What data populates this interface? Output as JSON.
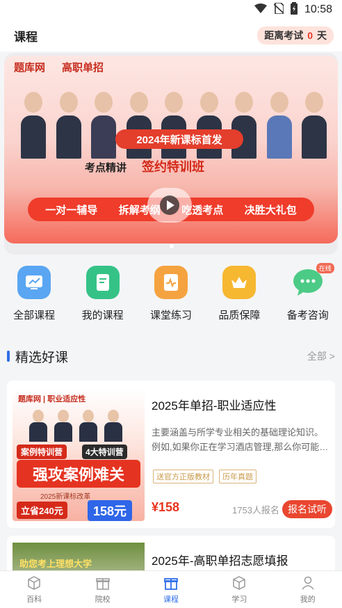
{
  "status_bar": {
    "time": "10:58",
    "icons": [
      "wifi-icon",
      "no-sim-icon",
      "battery-icon"
    ]
  },
  "header": {
    "title": "课程",
    "exam_label": "距离考试",
    "exam_days": "0",
    "exam_unit": "天"
  },
  "banner": {
    "brand_left": "题库网",
    "brand_right": "高职单招",
    "pill": "2024年新课标首发",
    "line_a": "考点精讲",
    "line_b": "签约特训班",
    "features": [
      "一对一辅导",
      "拆解考纲",
      "吃透考点",
      "决胜大礼包"
    ]
  },
  "quick_nav": [
    {
      "label": "全部课程",
      "icon": "chart-screen-icon",
      "color": "#5aa6f2"
    },
    {
      "label": "我的课程",
      "icon": "document-icon",
      "color": "#35c287"
    },
    {
      "label": "课堂练习",
      "icon": "pulse-doc-icon",
      "color": "#f5a340"
    },
    {
      "label": "品质保障",
      "icon": "crown-icon",
      "color": "#f6b731"
    },
    {
      "label": "备考咨询",
      "icon": "chat-bubble-icon",
      "color": "#4ccb86",
      "tag": "在线"
    }
  ],
  "section": {
    "title": "精选好课",
    "more": "全部 >"
  },
  "courses": [
    {
      "title": "2025年单招-职业适应性",
      "desc_line1": "主要涵盖与所学专业相关的基础理论知识。",
      "desc_line2": "例如,如果你正在学习酒店管理,那么你可能…",
      "tags": [
        "送官方正版教材",
        "历年真题"
      ],
      "price": "¥158",
      "enroll": "1753人报名",
      "button": "报名试听",
      "thumb": {
        "brand": "题库网 | 职业适应性",
        "tag1": "案例特训营",
        "tag2": "4大特训营",
        "headline": "强攻案例难关",
        "sub": "2025新课标改革",
        "left": "立省240元",
        "right": "158元"
      }
    },
    {
      "title": "2025年-高职单招志愿填报",
      "thumb": {
        "overlay": "助您考上理想大学"
      }
    }
  ],
  "tabbar": [
    {
      "label": "百科",
      "icon": "cube-icon",
      "active": false
    },
    {
      "label": "院校",
      "icon": "gift-icon",
      "active": false
    },
    {
      "label": "课程",
      "icon": "gift-icon",
      "active": true
    },
    {
      "label": "学习",
      "icon": "cube-icon",
      "active": false
    },
    {
      "label": "我的",
      "icon": "user-icon",
      "active": false
    }
  ]
}
